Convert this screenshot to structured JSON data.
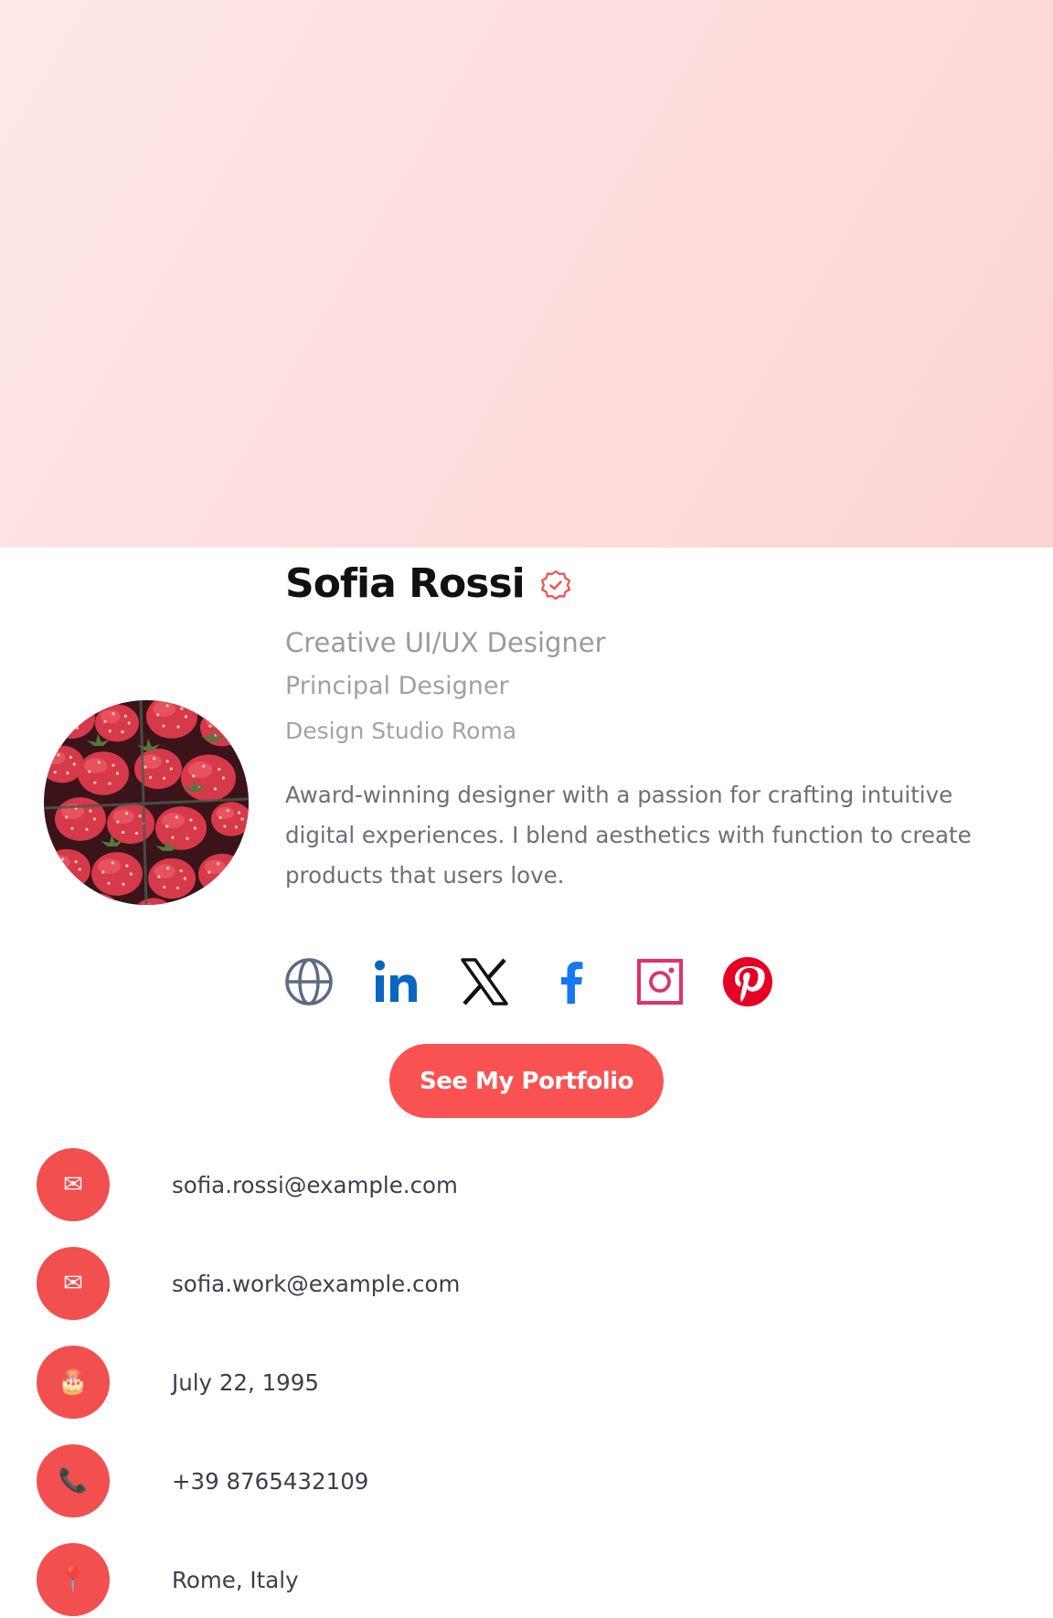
{
  "profile": {
    "name": "Sofia Rossi",
    "verified": true,
    "headline": "Creative UI/UX Designer",
    "role": "Principal Designer",
    "company": "Design Studio Roma",
    "bio": "Award-winning designer with a passion for crafting intuitive digital experiences. I blend aesthetics with function to create products that users love.",
    "avatar_icon": "strawberries-photo"
  },
  "socials": [
    {
      "name": "website",
      "icon": "globe-icon",
      "color": "#5c6b84"
    },
    {
      "name": "linkedin",
      "icon": "linkedin-icon",
      "color": "#0a66c2"
    },
    {
      "name": "x",
      "icon": "x-icon",
      "color": "#111111"
    },
    {
      "name": "facebook",
      "icon": "facebook-icon",
      "color": "#1877f2"
    },
    {
      "name": "instagram",
      "icon": "instagram-icon",
      "color": "#e1306c"
    },
    {
      "name": "pinterest",
      "icon": "pinterest-icon",
      "color": "#e60023"
    }
  ],
  "cta": {
    "label": "See My Portfolio"
  },
  "contacts": [
    {
      "icon": "mail-icon",
      "glyph": "✉",
      "value": "sofia.rossi@example.com"
    },
    {
      "icon": "mail-icon",
      "glyph": "✉",
      "value": "sofia.work@example.com"
    },
    {
      "icon": "cake-icon",
      "glyph": "🎂",
      "value": "July 22, 1995"
    },
    {
      "icon": "phone-icon",
      "glyph": "📞",
      "value": "+39 8765432109"
    },
    {
      "icon": "pin-icon",
      "glyph": "📍",
      "value": "Rome, Italy"
    }
  ],
  "colors": {
    "accent": "#fa5252",
    "banner": "#fedddd",
    "verified": "#f24f4f"
  }
}
